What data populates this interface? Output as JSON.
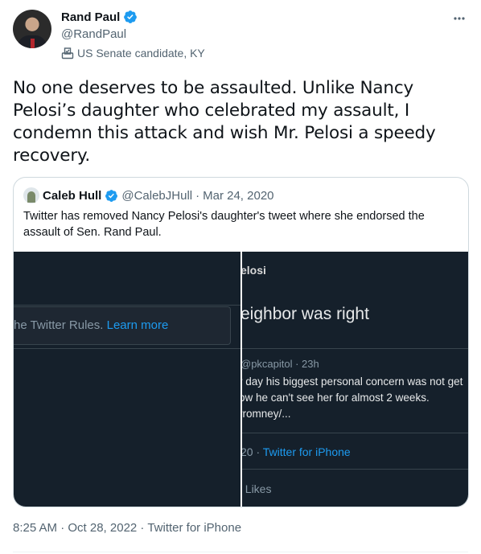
{
  "author": {
    "display_name": "Rand Paul",
    "handle": "@RandPaul",
    "label": "US Senate candidate, KY",
    "verified": true,
    "label_icon": "ballot-box-icon"
  },
  "more_icon": "more-horizontal-icon",
  "tweet": {
    "text": "No one deserves to be assaulted. Unlike Nancy Pelosi’s daughter who celebrated my assault, I condemn this attack and wish Mr. Pelosi a speedy recovery."
  },
  "quote": {
    "display_name": "Caleb Hull",
    "handle": "@CalebJHull",
    "date": "Mar 24, 2020",
    "separator": "·",
    "verified": true,
    "text": "Twitter has removed Nancy Pelosi's daughter's tweet where she endorsed the assault of Sen. Rand Paul.",
    "media": {
      "left": {
        "notice_text": "he Twitter Rules.",
        "notice_link": "Learn more"
      },
      "right": {
        "name": "elosi",
        "headline": "eighbor was right",
        "meta": "@pkcapitol · 23h",
        "body_lines": [
          "r day his biggest personal concern was not get",
          "ow he can't see her for almost 2 weeks.",
          "rromney/..."
        ],
        "foot_prefix": "20 · ",
        "foot_link": "Twitter for iPhone",
        "likes": "Likes"
      }
    }
  },
  "footer": {
    "timestamp": "8:25 AM · Oct 28, 2022 · Twitter for iPhone"
  },
  "colors": {
    "verified_blue": "#1d9bf0",
    "secondary_text": "#536471",
    "dark_bg": "#15202b"
  }
}
